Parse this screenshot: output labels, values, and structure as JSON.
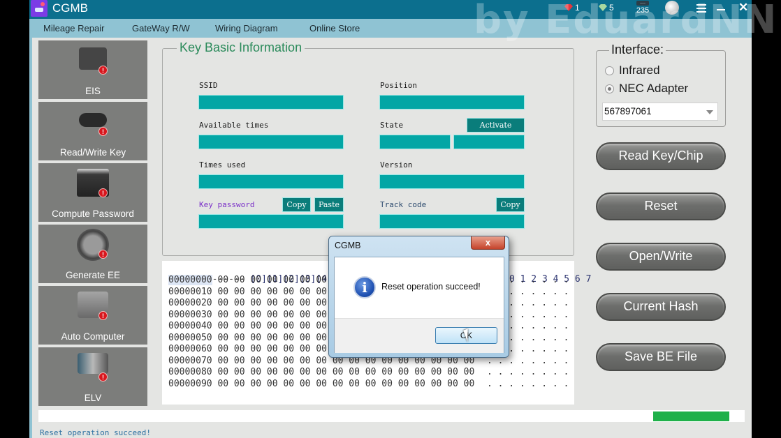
{
  "window": {
    "title": "CGMB",
    "watermark": "by EduardNN",
    "status_icons": {
      "red_gem_count": "1",
      "green_gem_count": "5",
      "counter_value": "235",
      "counter_dots": "...."
    },
    "colors": {
      "titlebar": "#0c6f8e",
      "menubar": "#8fc3d3",
      "field": "#03a6a5",
      "progress": "#1fb04a"
    }
  },
  "menu": [
    {
      "label": "Mileage Repair"
    },
    {
      "label": "GateWay R/W"
    },
    {
      "label": "Wiring Diagram"
    },
    {
      "label": "Online Store"
    }
  ],
  "sidebar": {
    "items": [
      {
        "label": "EIS",
        "icon": "ignition-switch-icon"
      },
      {
        "label": "Read/Write Key",
        "icon": "car-key-icon"
      },
      {
        "label": "Compute Password",
        "icon": "monitor-icon"
      },
      {
        "label": "Generate EE",
        "icon": "printer-icon"
      },
      {
        "label": "Auto Computer",
        "icon": "ecu-icon"
      },
      {
        "label": "ELV",
        "icon": "circuit-board-icon"
      }
    ],
    "badge_glyph": "!"
  },
  "key_info": {
    "title": "Key Basic Information",
    "fields": {
      "ssid": {
        "label": "SSID",
        "value": ""
      },
      "available_times": {
        "label": "Available times",
        "value": ""
      },
      "times_used": {
        "label": "Times used",
        "value": ""
      },
      "key_password": {
        "label": "Key password",
        "value": ""
      },
      "position": {
        "label": "Position",
        "value": ""
      },
      "state": {
        "label": "State",
        "value_a": "",
        "value_b": ""
      },
      "version": {
        "label": "Version",
        "value": ""
      },
      "track_code": {
        "label": "Track code",
        "value": ""
      }
    },
    "buttons": {
      "copy": "Copy",
      "paste": "Paste",
      "activate": "Activate",
      "track_copy": "Copy"
    }
  },
  "hex_view": {
    "header_prefix": "--------",
    "header_columns": "[0][1][2][3][4][5][6]",
    "ascii_header": "0 1 2 3 4 5 6 7",
    "rows": [
      {
        "addr": "00000000",
        "bytes": "00 00 00 00 00 00 00 00 00 00 00 00 00 00 00 00",
        "ascii": ". . . . . . . ."
      },
      {
        "addr": "00000010",
        "bytes": "00 00 00 00 00 00 00 00 00 00 00 00 00 00 00 00",
        "ascii": ". . . . . . . ."
      },
      {
        "addr": "00000020",
        "bytes": "00 00 00 00 00 00 00 00 00 00 00 00 00 00 00 00",
        "ascii": ". . . . . . . ."
      },
      {
        "addr": "00000030",
        "bytes": "00 00 00 00 00 00 00 00 00 00 00 00 00 00 00 00",
        "ascii": ". . . . . . . ."
      },
      {
        "addr": "00000040",
        "bytes": "00 00 00 00 00 00 00 00 00 00 00 00 00 00 00 00",
        "ascii": ". . . . . . . ."
      },
      {
        "addr": "00000050",
        "bytes": "00 00 00 00 00 00 00 00 00 00 00 00 00 00 00 00",
        "ascii": ". . . . . . . ."
      },
      {
        "addr": "00000060",
        "bytes": "00 00 00 00 00 00 00 00 00 00 00 00 00 00 00 00",
        "ascii": ". . . . . . . ."
      },
      {
        "addr": "00000070",
        "bytes": "00 00 00 00 00 00 00 00 00 00 00 00 00 00 00 00",
        "ascii": ". . . . . . . ."
      },
      {
        "addr": "00000080",
        "bytes": "00 00 00 00 00 00 00 00 00 00 00 00 00 00 00 00",
        "ascii": ". . . . . . . ."
      },
      {
        "addr": "00000090",
        "bytes": "00 00 00 00 00 00 00 00 00 00 00 00 00 00 00 00",
        "ascii": ". . . . . . . ."
      }
    ]
  },
  "interface": {
    "title": "Interface:",
    "options": [
      {
        "label": "Infrared",
        "selected": false
      },
      {
        "label": "NEC Adapter",
        "selected": true
      }
    ],
    "adapter_value": "567897061"
  },
  "actions": [
    {
      "label": "Read Key/Chip"
    },
    {
      "label": "Reset"
    },
    {
      "label": "Open/Write"
    },
    {
      "label": "Current Hash"
    },
    {
      "label": "Save BE File"
    }
  ],
  "progress": {
    "segment_start_percent": 87,
    "segment_end_percent": 97.8
  },
  "status_text": "Reset operation succeed!",
  "dialog": {
    "title": "CGMB",
    "close_glyph": "x",
    "message": "Reset operation succeed!",
    "ok_label": "OK",
    "icon_glyph": "i"
  }
}
